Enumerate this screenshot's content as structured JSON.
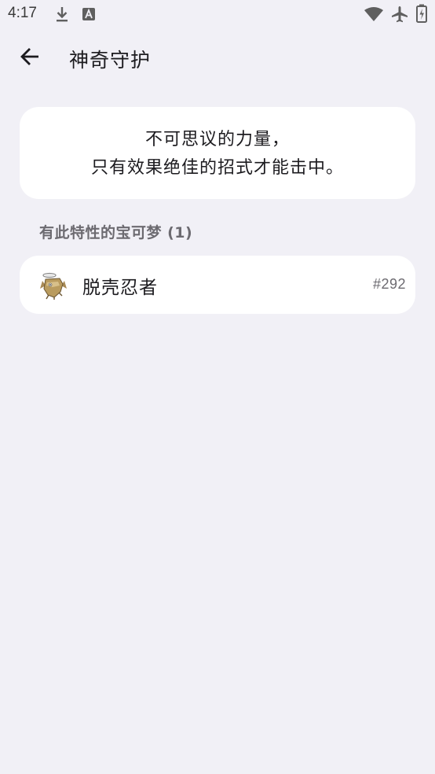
{
  "status_bar": {
    "time": "4:17",
    "icons": [
      "download-icon",
      "font-a-icon",
      "wifi-icon",
      "airplane-icon",
      "battery-icon"
    ]
  },
  "app_bar": {
    "title": "神奇守护",
    "back_icon": "arrow-back-icon"
  },
  "description": {
    "line1": "不可思议的力量，",
    "line2": "只有效果绝佳的招式才能击中。"
  },
  "section": {
    "header": "有此特性的宝可梦 (1)"
  },
  "pokemon": [
    {
      "name": "脱壳忍者",
      "number": "#292",
      "icon": "shedinja-sprite"
    }
  ],
  "colors": {
    "background": "#f1f0f6",
    "card": "#ffffff",
    "text_primary": "#1c1b1f",
    "text_secondary": "#6c6a70"
  }
}
